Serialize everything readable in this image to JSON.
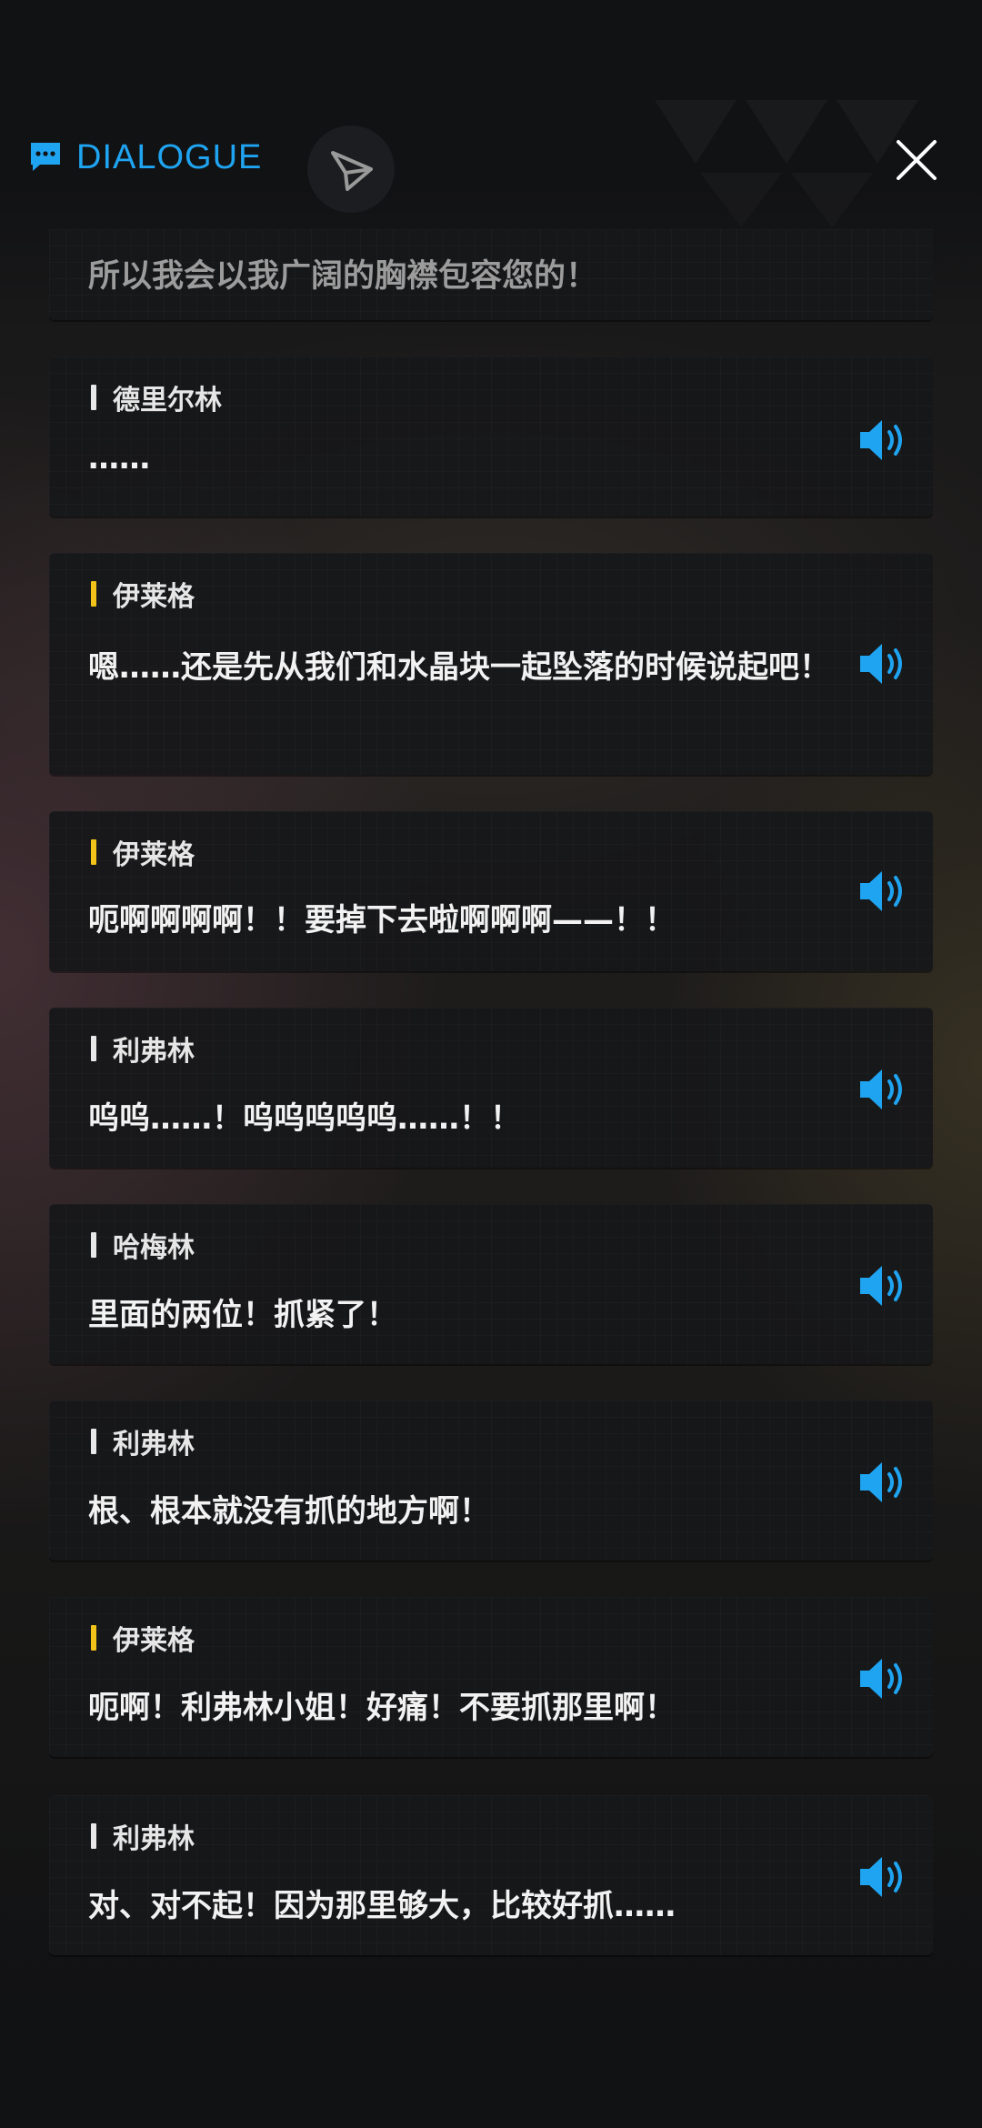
{
  "header": {
    "title": "DIALOGUE",
    "icons": {
      "chat": "chat-bubble-icon",
      "send": "send-icon",
      "close": "close-icon"
    },
    "accent_color": "#1fa4f1"
  },
  "previous_line": "所以我会以我广阔的胸襟包容您的！",
  "dialogues": [
    {
      "speaker": "德里尔林",
      "text": "……",
      "bar_color": "#e8e8e8"
    },
    {
      "speaker": "伊莱格",
      "text": "嗯……还是先从我们和水晶块一起坠落的时候说起吧！",
      "bar_color": "#f2c318"
    },
    {
      "speaker": "伊莱格",
      "text": "呃啊啊啊啊！！要掉下去啦啊啊啊——！！",
      "bar_color": "#f2c318"
    },
    {
      "speaker": "利弗林",
      "text": "呜呜……！呜呜呜呜呜……！！",
      "bar_color": "#e8e8e8"
    },
    {
      "speaker": "哈梅林",
      "text": "里面的两位！抓紧了！",
      "bar_color": "#e8e8e8"
    },
    {
      "speaker": "利弗林",
      "text": "根、根本就没有抓的地方啊！",
      "bar_color": "#e8e8e8"
    },
    {
      "speaker": "伊莱格",
      "text": "呃啊！利弗林小姐！好痛！不要抓那里啊！",
      "bar_color": "#f2c318"
    },
    {
      "speaker": "利弗林",
      "text": "对、对不起！因为那里够大，比较好抓……",
      "bar_color": "#e8e8e8"
    }
  ],
  "voice_icon": "speaker-volume-icon"
}
